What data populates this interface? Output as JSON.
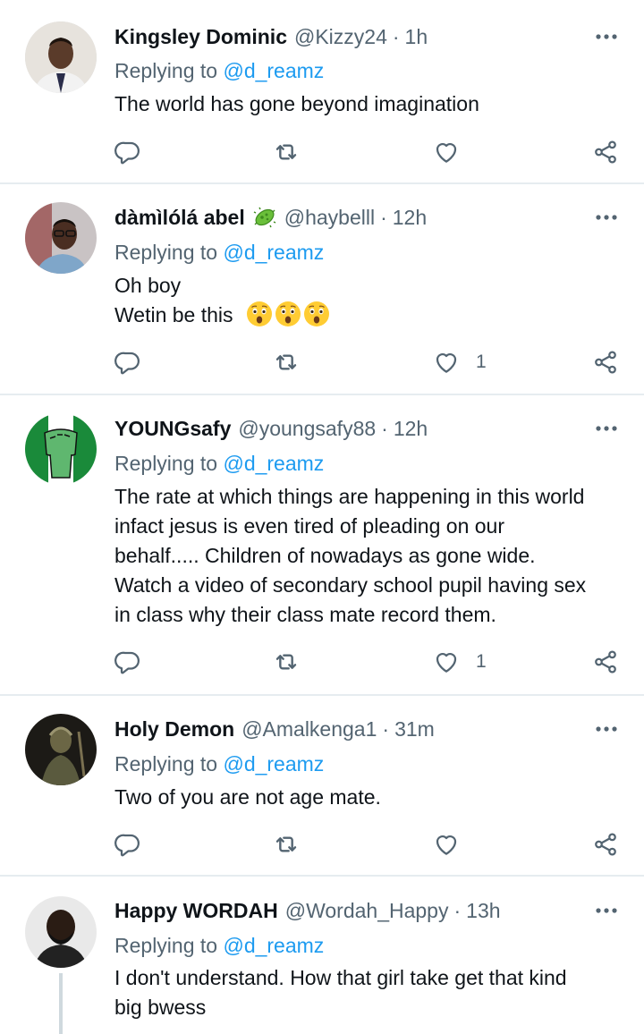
{
  "replying_label": "Replying to",
  "tweets": [
    {
      "name": "Kingsley Dominic",
      "handle": "@Kizzy24",
      "sep": "·",
      "time": "1h",
      "reply_to": "@d_reamz",
      "lines": [
        "The world has gone beyond imagination"
      ],
      "like_count": ""
    },
    {
      "name": "dàmìlólá abel",
      "badge_icon": "microbe-emoji-icon",
      "handle": "@haybelll",
      "sep": "·",
      "time": "12h",
      "reply_to": "@d_reamz",
      "lines": [
        "Oh boy",
        "Wetin be this"
      ],
      "emoji_icon": "astonished-face-emoji-icon",
      "like_count": "1"
    },
    {
      "name": "YOUNGsafy",
      "handle": "@youngsafy88",
      "sep": "·",
      "time": "12h",
      "reply_to": "@d_reamz",
      "lines": [
        "The rate at which things are happening in this world",
        "infact jesus is even tired of pleading on our",
        "behalf..... Children of nowadays as gone wide.",
        "Watch a video of secondary school pupil having sex",
        "in class why their class mate record them."
      ],
      "like_count": "1"
    },
    {
      "name": "Holy Demon",
      "handle": "@Amalkenga1",
      "sep": "·",
      "time": "31m",
      "reply_to": "@d_reamz",
      "lines": [
        "Two of you are not age mate."
      ],
      "like_count": ""
    },
    {
      "name": "Happy WORDAH",
      "handle": "@Wordah_Happy",
      "sep": "·",
      "time": "13h",
      "reply_to": "@d_reamz",
      "lines": [
        "I don't understand. How that girl take get that kind",
        "big bwess"
      ]
    }
  ],
  "colors": {
    "link": "#1d9bf0",
    "muted": "#536471",
    "divider": "#e6ecf0"
  }
}
